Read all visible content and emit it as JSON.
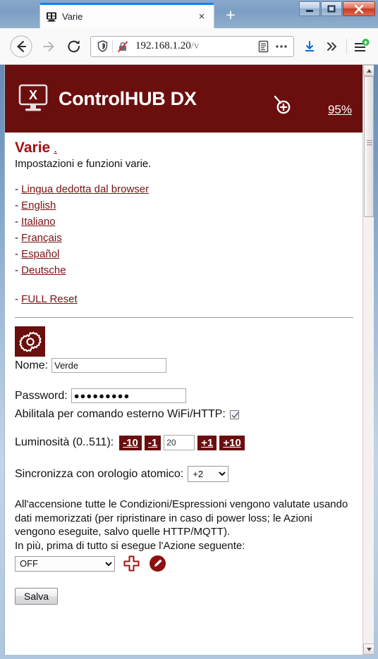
{
  "browser": {
    "tab": {
      "title": "Varie",
      "favicon": "display-favicon",
      "close_label": "×"
    },
    "new_tab_label": "+",
    "window_controls": {
      "minimize": "minimize-icon",
      "maximize": "maximize-icon",
      "close": "close-icon"
    },
    "toolbar": {
      "back": "back-arrow-icon",
      "forward": "forward-arrow-icon",
      "reload": "reload-icon",
      "shield": "shield-icon",
      "insecure": "lock-crossed-icon",
      "url_host": "192.168.1.20",
      "url_path": "/v",
      "reader": "reader-mode-icon",
      "page_actions": "ellipsis-icon",
      "downloads": "download-arrow-icon",
      "overflow": "chevron-double-right-icon",
      "app_menu": "hamburger-menu-icon",
      "update_badge": "update-arrow-badge"
    }
  },
  "site": {
    "logo": "display-x-icon",
    "title": "ControlHUB DX",
    "zoom_icon": "zoom-in-magnifier-icon",
    "zoom_level": "95%",
    "header_color": "#6b0e0e",
    "link_color": "#7a1111"
  },
  "page": {
    "title": "Varie",
    "title_link": ".",
    "subtitle": "Impostazioni e funzioni varie.",
    "language_links": [
      {
        "bullet": "-",
        "label": "Lingua dedotta dal browser"
      },
      {
        "bullet": "-",
        "label": "English"
      },
      {
        "bullet": "-",
        "label": "Italiano"
      },
      {
        "bullet": "-",
        "label": "Français"
      },
      {
        "bullet": "-",
        "label": "Español"
      },
      {
        "bullet": "-",
        "label": "Deutsche"
      }
    ],
    "reset": {
      "bullet": "-",
      "label": "FULL Reset"
    }
  },
  "settings": {
    "gear_icon": "gear-icon",
    "name_label": "Nome:",
    "name_value": "Verde",
    "password_label": "Password:",
    "password_value": "●●●●●●●●●",
    "wifi_label": "Abilitala per comando esterno WiFi/HTTP:",
    "wifi_checked": true,
    "brightness_label": "Luminosità (0..511):",
    "brightness_minus10": "-10",
    "brightness_minus1": "-1",
    "brightness_value": "20",
    "brightness_plus1": "+1",
    "brightness_plus10": "+10",
    "clock_label": "Sincronizza con orologio atomico:",
    "clock_value": "+2",
    "clock_options": [
      "+2"
    ]
  },
  "notice": {
    "line1": "All'accensione tutte le Condizioni/Espressioni vengono valutate usando dati memorizzati (per ripristinare in caso di power loss; le Azioni vengono eseguite, salvo quelle HTTP/MQTT).",
    "line2": "In più, prima di tutto si esegue l'Azione seguente:"
  },
  "action": {
    "value": "OFF",
    "options": [
      "OFF"
    ],
    "add_icon": "plus-cross-icon",
    "edit_icon": "pencil-circle-icon"
  },
  "footer": {
    "save_label": "Salva"
  },
  "scrollbar": {
    "up": "scroll-up-arrow-icon",
    "down": "scroll-down-arrow-icon",
    "thumb": "scroll-thumb"
  }
}
